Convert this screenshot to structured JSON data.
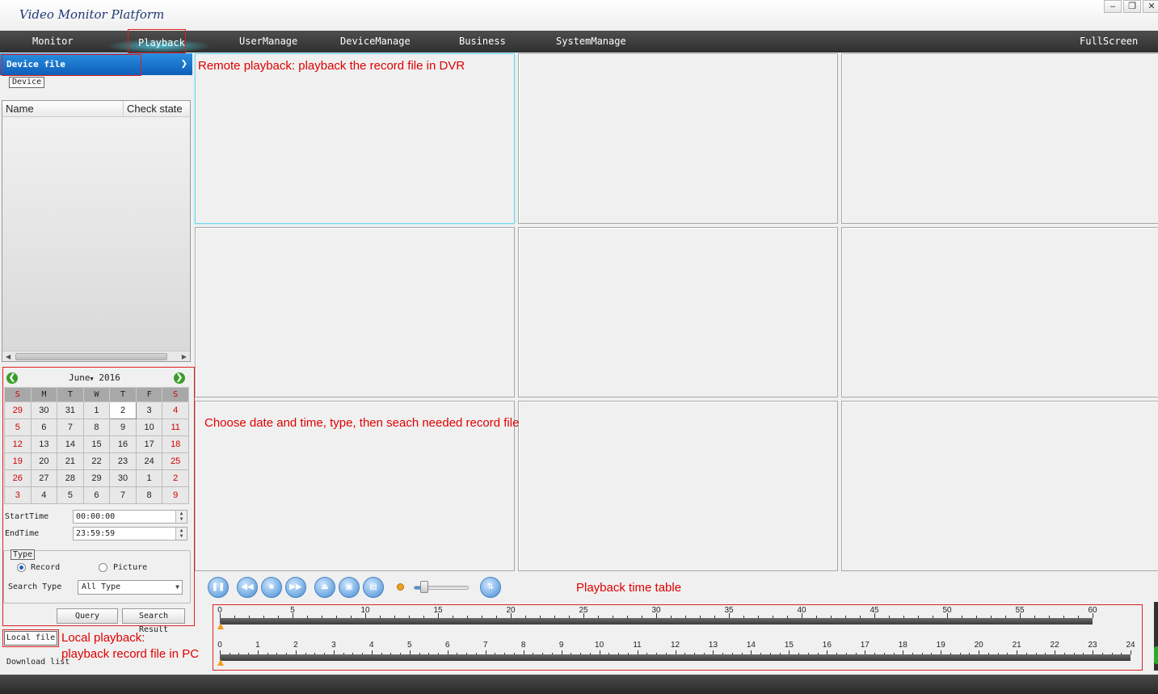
{
  "app": {
    "title": "Video Monitor Platform"
  },
  "window_controls": {
    "minimize": "–",
    "restore": "❐",
    "close": "✕"
  },
  "menu": {
    "items": [
      "Monitor",
      "Playback",
      "UserManage",
      "DeviceManage",
      "Business",
      "SystemManage"
    ],
    "active": "Playback",
    "fullscreen": "FullScreen"
  },
  "sidebar": {
    "header": "Device file",
    "tab": "Device",
    "columns": [
      "Name",
      "Check state"
    ]
  },
  "calendar": {
    "month": "June",
    "year": "2016",
    "weekdays": [
      "S",
      "M",
      "T",
      "W",
      "T",
      "F",
      "S"
    ],
    "weeks": [
      [
        "29",
        "30",
        "31",
        "1",
        "2",
        "3",
        "4"
      ],
      [
        "5",
        "6",
        "7",
        "8",
        "9",
        "10",
        "11"
      ],
      [
        "12",
        "13",
        "14",
        "15",
        "16",
        "17",
        "18"
      ],
      [
        "19",
        "20",
        "21",
        "22",
        "23",
        "24",
        "25"
      ],
      [
        "26",
        "27",
        "28",
        "29",
        "30",
        "1",
        "2"
      ],
      [
        "3",
        "4",
        "5",
        "6",
        "7",
        "8",
        "9"
      ]
    ],
    "selected": "2"
  },
  "time": {
    "start_label": "StartTime",
    "start_value": "00:00:00",
    "end_label": "EndTime",
    "end_value": "23:59:59"
  },
  "type_group": {
    "legend": "Type",
    "option_record": "Record",
    "option_picture": "Picture",
    "selected": "Record",
    "search_type_label": "Search Type",
    "search_type_value": "All Type"
  },
  "buttons": {
    "query": "Query",
    "search_result": "Search Result"
  },
  "bottom_tabs": {
    "local_file": "Local file",
    "download_list": "Download list"
  },
  "timeline": {
    "minute_ticks": [
      "0",
      "5",
      "10",
      "15",
      "20",
      "25",
      "30",
      "35",
      "40",
      "45",
      "50",
      "55",
      "60"
    ],
    "hour_ticks": [
      "0",
      "1",
      "2",
      "3",
      "4",
      "5",
      "6",
      "7",
      "8",
      "9",
      "10",
      "11",
      "12",
      "13",
      "14",
      "15",
      "16",
      "17",
      "18",
      "19",
      "20",
      "21",
      "22",
      "23",
      "24"
    ]
  },
  "annotations": {
    "remote": "Remote playback: playback the record file in DVR",
    "choose": "Choose date and time, type, then seach needed record file",
    "timetable": "Playback time table",
    "local_line1": "Local playback:",
    "local_line2": "playback record file in PC"
  },
  "colors": {
    "annotation": "#e00000",
    "header_blue": "#1e74d0",
    "menu_bg": "#3a3a3a",
    "active_cell": "#6fd6e8"
  }
}
